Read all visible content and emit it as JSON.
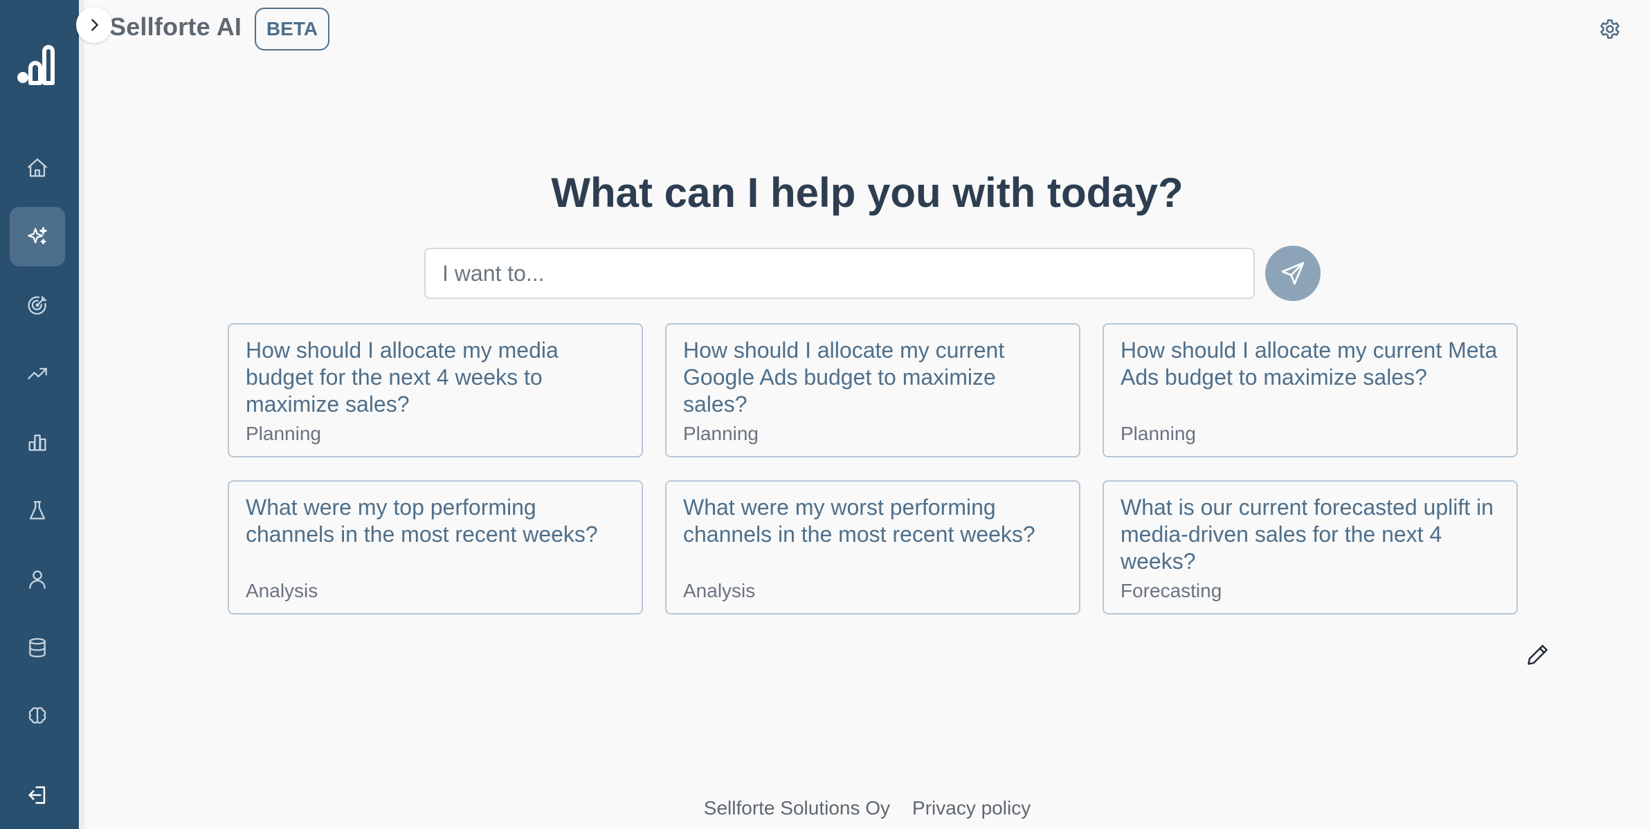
{
  "header": {
    "app_title": "Sellforte AI",
    "badge": "BETA"
  },
  "sidebar": {
    "items": [
      {
        "icon": "home-icon"
      },
      {
        "icon": "sparkles-icon",
        "active": true
      },
      {
        "icon": "target-icon"
      },
      {
        "icon": "trending-up-icon"
      },
      {
        "icon": "bar-chart-icon"
      },
      {
        "icon": "flask-icon"
      },
      {
        "icon": "user-icon"
      },
      {
        "icon": "database-icon"
      },
      {
        "icon": "brain-icon"
      },
      {
        "icon": "logout-icon"
      }
    ]
  },
  "main": {
    "headline": "What can I help you with today?",
    "search": {
      "placeholder": "I want to...",
      "value": ""
    },
    "suggestions": [
      {
        "question": "How should I allocate my media budget for the next 4 weeks to maximize sales?",
        "category": "Planning"
      },
      {
        "question": "How should I allocate my current Google Ads budget to maximize sales?",
        "category": "Planning"
      },
      {
        "question": "How should I allocate my current Meta Ads budget to maximize sales?",
        "category": "Planning"
      },
      {
        "question": "What were my top performing channels in the most recent weeks?",
        "category": "Analysis"
      },
      {
        "question": "What were my worst performing channels in the most recent weeks?",
        "category": "Analysis"
      },
      {
        "question": "What is our current forecasted uplift in media-driven sales for the next 4 weeks?",
        "category": "Forecasting"
      }
    ]
  },
  "footer": {
    "company": "Sellforte Solutions Oy",
    "privacy": "Privacy policy"
  },
  "colors": {
    "sidebar": "#29506f",
    "active_nav": "#4e6f8b",
    "accent": "#4e6f8b",
    "send_button": "#8da4b8",
    "background": "#f9f9f9"
  }
}
